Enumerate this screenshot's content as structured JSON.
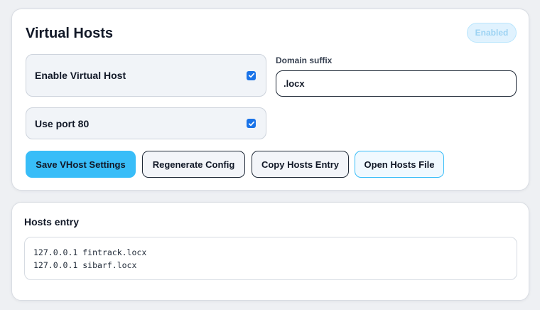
{
  "vhost_card": {
    "title": "Virtual Hosts",
    "status_badge": "Enabled",
    "enable_vhost": {
      "label": "Enable Virtual Host",
      "checked": true
    },
    "use_port_80": {
      "label": "Use port 80",
      "checked": true
    },
    "domain_suffix": {
      "label": "Domain suffix",
      "value": ".locx"
    },
    "buttons": {
      "save": "Save VHost Settings",
      "regenerate": "Regenerate Config",
      "copy": "Copy Hosts Entry",
      "open": "Open Hosts File"
    }
  },
  "hosts_card": {
    "title": "Hosts entry",
    "lines": [
      "127.0.0.1 fintrack.locx",
      "127.0.0.1 sibarf.locx"
    ]
  },
  "colors": {
    "accent": "#38bdf8",
    "checkbox": "#1a73e8",
    "badge_bg": "#e0f2fe",
    "badge_text": "#9dd3f3"
  },
  "icons": {
    "checkbox_checked": "check-icon"
  }
}
